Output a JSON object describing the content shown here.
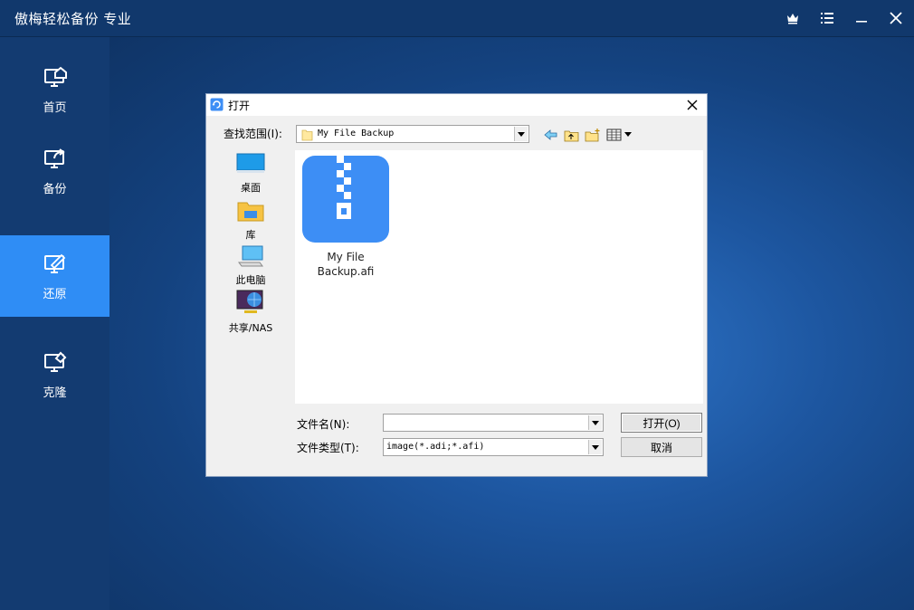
{
  "app": {
    "title": "傲梅轻松备份 专业",
    "window_controls": [
      "crown-icon",
      "menu-icon",
      "minimize-icon",
      "close-icon"
    ]
  },
  "sidebar": {
    "items": [
      {
        "label": "首页",
        "icon": "home-monitor-icon",
        "active": false
      },
      {
        "label": "备份",
        "icon": "backup-monitor-icon",
        "active": false
      },
      {
        "label": "还原",
        "icon": "restore-monitor-icon",
        "active": true
      },
      {
        "label": "克隆",
        "icon": "clone-monitor-icon",
        "active": false
      }
    ]
  },
  "dialog": {
    "title": "打开",
    "look_in_label": "查找范围(I):",
    "look_in_value": "My File Backup",
    "toolbar_icons": [
      "back-icon",
      "up-folder-icon",
      "new-folder-icon",
      "view-menu-icon"
    ],
    "places": [
      {
        "label": "桌面",
        "icon": "desktop-icon"
      },
      {
        "label": "库",
        "icon": "library-icon"
      },
      {
        "label": "此电脑",
        "icon": "this-pc-icon"
      },
      {
        "label": "共享/NAS",
        "icon": "network-share-icon"
      }
    ],
    "files": [
      {
        "name_line1": "My File",
        "name_line2": "Backup.afi",
        "icon": "archive-zip-icon"
      }
    ],
    "file_name_label": "文件名(N):",
    "file_name_value": "",
    "file_type_label": "文件类型(T):",
    "file_type_value": "image(*.adi;*.afi)",
    "open_button": "打开(O)",
    "cancel_button": "取消"
  },
  "colors": {
    "titlebar": "#11386c",
    "sidebar": "#133b71",
    "active_nav": "#2f8df5",
    "zip_icon": "#3d8ef5"
  }
}
